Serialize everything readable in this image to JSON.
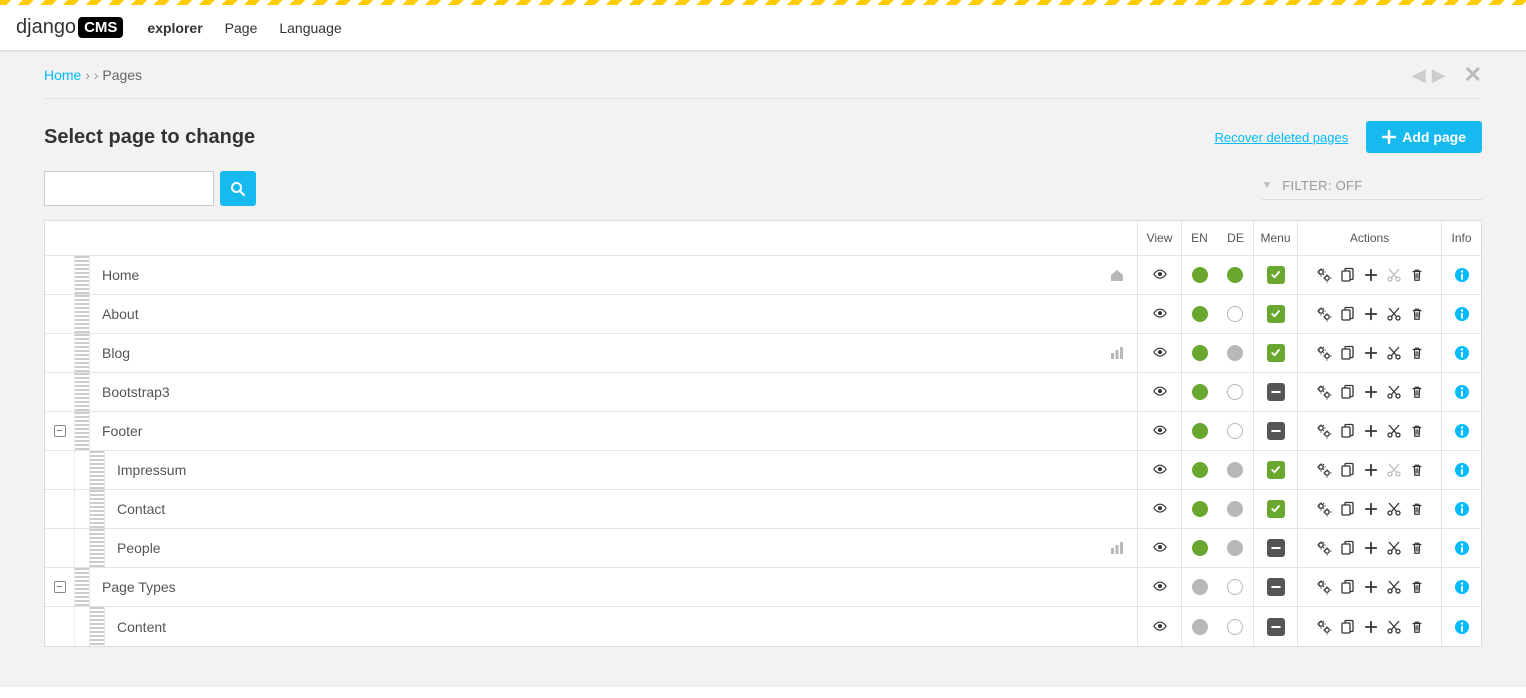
{
  "brand": {
    "main": "django",
    "box": "CMS"
  },
  "toolbar": {
    "items": [
      {
        "label": "explorer",
        "bold": true
      },
      {
        "label": "Page",
        "bold": false
      },
      {
        "label": "Language",
        "bold": false
      }
    ]
  },
  "breadcrumb": {
    "home": "Home",
    "sep": "› ›",
    "current": "Pages"
  },
  "header": {
    "title": "Select page to change",
    "recover_link": "Recover deleted pages",
    "add_button": "Add page"
  },
  "search": {
    "value": ""
  },
  "filter": {
    "label": "FILTER: OFF"
  },
  "columns": {
    "view": "View",
    "en": "EN",
    "de": "DE",
    "menu": "Menu",
    "actions": "Actions",
    "info": "Info"
  },
  "rows": [
    {
      "depth": 0,
      "toggle": null,
      "name": "Home",
      "icon": "home",
      "en": "green",
      "de": "green",
      "menu": "check",
      "cut_disabled": true
    },
    {
      "depth": 0,
      "toggle": null,
      "name": "About",
      "icon": null,
      "en": "green",
      "de": "outline",
      "menu": "check",
      "cut_disabled": false
    },
    {
      "depth": 0,
      "toggle": null,
      "name": "Blog",
      "icon": "app",
      "en": "green",
      "de": "grey",
      "menu": "check",
      "cut_disabled": false
    },
    {
      "depth": 0,
      "toggle": null,
      "name": "Bootstrap3",
      "icon": null,
      "en": "green",
      "de": "outline",
      "menu": "minus",
      "cut_disabled": false
    },
    {
      "depth": 0,
      "toggle": "minus",
      "name": "Footer",
      "icon": null,
      "en": "green",
      "de": "outline",
      "menu": "minus",
      "cut_disabled": false
    },
    {
      "depth": 1,
      "toggle": null,
      "name": "Impressum",
      "icon": null,
      "en": "green",
      "de": "grey",
      "menu": "check",
      "cut_disabled": true
    },
    {
      "depth": 1,
      "toggle": null,
      "name": "Contact",
      "icon": null,
      "en": "green",
      "de": "grey",
      "menu": "check",
      "cut_disabled": false
    },
    {
      "depth": 1,
      "toggle": null,
      "name": "People",
      "icon": "app",
      "en": "green",
      "de": "grey",
      "menu": "minus",
      "cut_disabled": false
    },
    {
      "depth": 0,
      "toggle": "minus",
      "name": "Page Types",
      "icon": null,
      "en": "grey",
      "de": "outline",
      "menu": "minus",
      "cut_disabled": false
    },
    {
      "depth": 1,
      "toggle": null,
      "name": "Content",
      "icon": null,
      "en": "grey",
      "de": "outline",
      "menu": "minus",
      "cut_disabled": false
    }
  ]
}
